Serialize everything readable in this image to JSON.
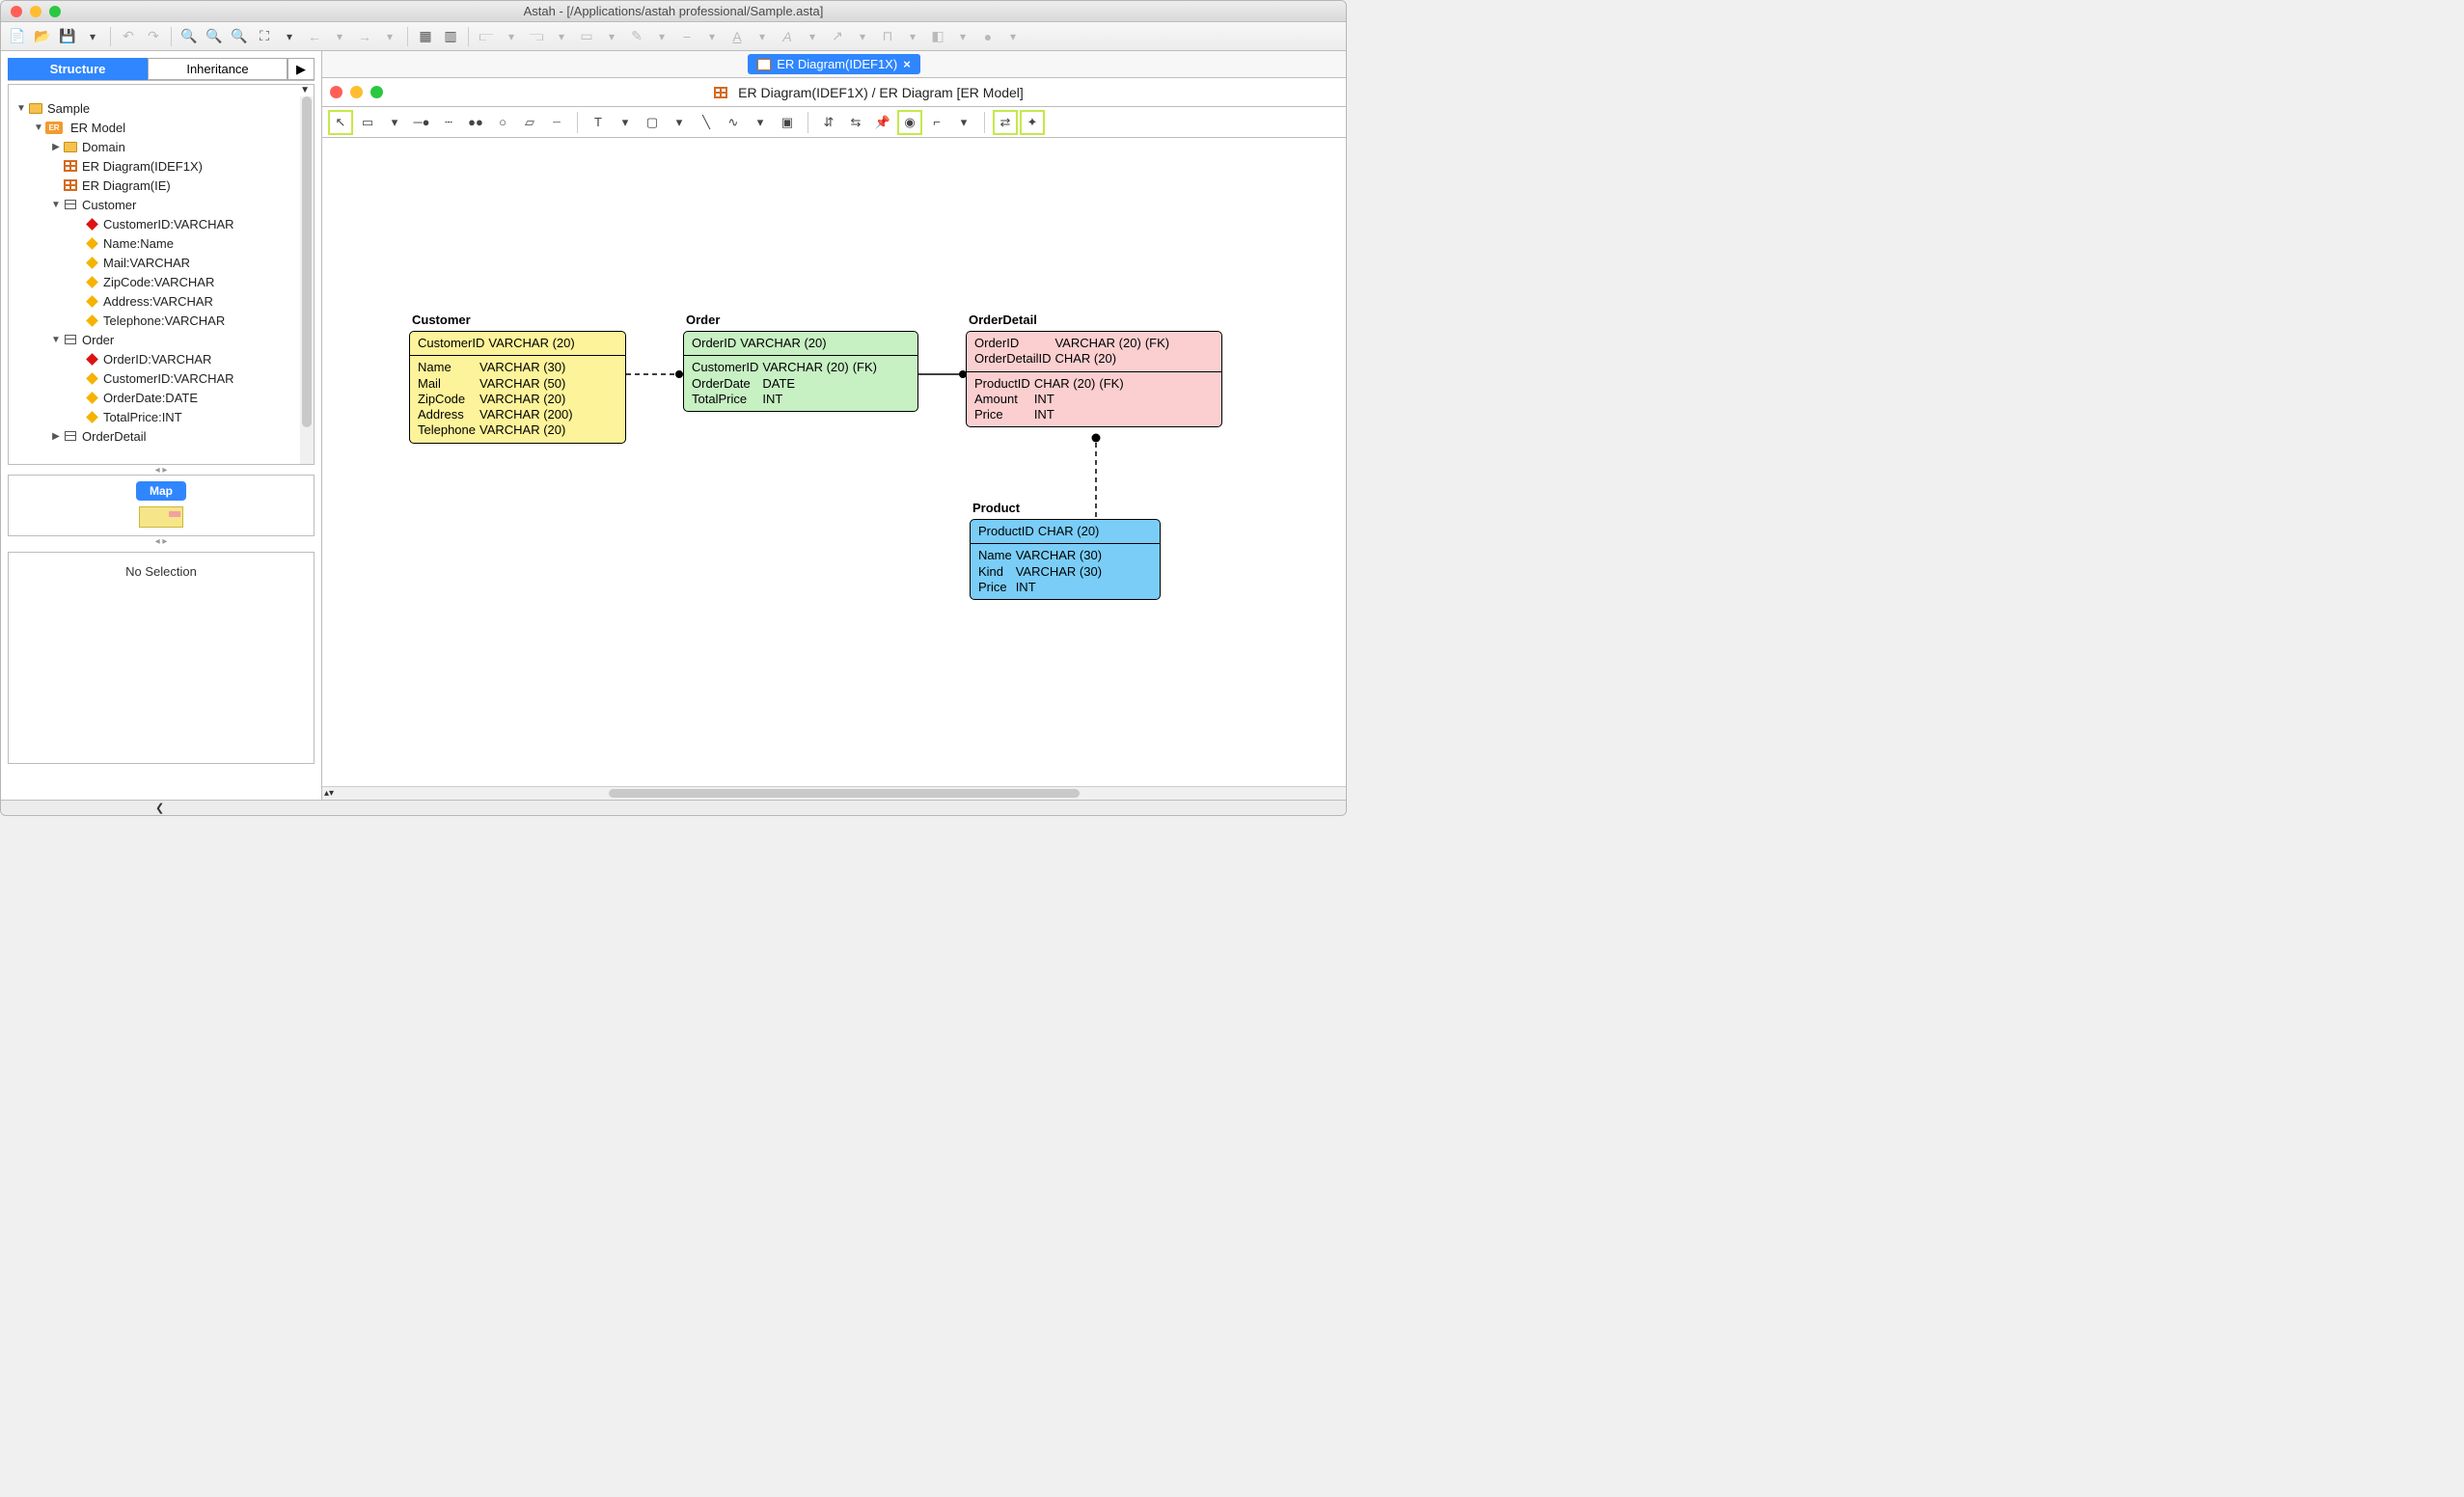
{
  "window_title": "Astah - [/Applications/astah professional/Sample.asta]",
  "left_tabs": {
    "structure": "Structure",
    "inheritance": "Inheritance"
  },
  "tree": {
    "root": "Sample",
    "model": "ER Model",
    "domain": "Domain",
    "diag1": "ER Diagram(IDEF1X)",
    "diag2": "ER Diagram(IE)",
    "customer": "Customer",
    "customer_attrs": [
      "CustomerID:VARCHAR",
      "Name:Name",
      "Mail:VARCHAR",
      "ZipCode:VARCHAR",
      "Address:VARCHAR",
      "Telephone:VARCHAR"
    ],
    "order": "Order",
    "order_attrs": [
      "OrderID:VARCHAR",
      "CustomerID:VARCHAR",
      "OrderDate:DATE",
      "TotalPrice:INT"
    ],
    "orderdetail": "OrderDetail"
  },
  "map_label": "Map",
  "no_selection": "No Selection",
  "doc_tab": "ER Diagram(IDEF1X)",
  "doc_title": "ER Diagram(IDEF1X) / ER Diagram [ER Model]",
  "entities": {
    "customer": {
      "name": "Customer",
      "pk": [
        [
          "CustomerID",
          "VARCHAR (20)"
        ]
      ],
      "attrs": [
        [
          "Name",
          "VARCHAR (30)"
        ],
        [
          "Mail",
          "VARCHAR (50)"
        ],
        [
          "ZipCode",
          "VARCHAR (20)"
        ],
        [
          "Address",
          "VARCHAR (200)"
        ],
        [
          "Telephone",
          "VARCHAR (20)"
        ]
      ]
    },
    "order": {
      "name": "Order",
      "pk": [
        [
          "OrderID",
          "VARCHAR (20)"
        ]
      ],
      "attrs": [
        [
          "CustomerID",
          "VARCHAR (20)",
          "(FK)"
        ],
        [
          "OrderDate",
          "DATE",
          ""
        ],
        [
          "TotalPrice",
          "INT",
          ""
        ]
      ]
    },
    "orderdetail": {
      "name": "OrderDetail",
      "pk": [
        [
          "OrderID",
          "VARCHAR (20)",
          "(FK)"
        ],
        [
          "OrderDetailID",
          "CHAR (20)",
          ""
        ]
      ],
      "attrs": [
        [
          "ProductID",
          "CHAR (20)",
          "(FK)"
        ],
        [
          "Amount",
          "INT",
          ""
        ],
        [
          "Price",
          "INT",
          ""
        ]
      ]
    },
    "product": {
      "name": "Product",
      "pk": [
        [
          "ProductID",
          "CHAR (20)"
        ]
      ],
      "attrs": [
        [
          "Name",
          "VARCHAR (30)"
        ],
        [
          "Kind",
          "VARCHAR (30)"
        ],
        [
          "Price",
          "INT"
        ]
      ]
    }
  }
}
